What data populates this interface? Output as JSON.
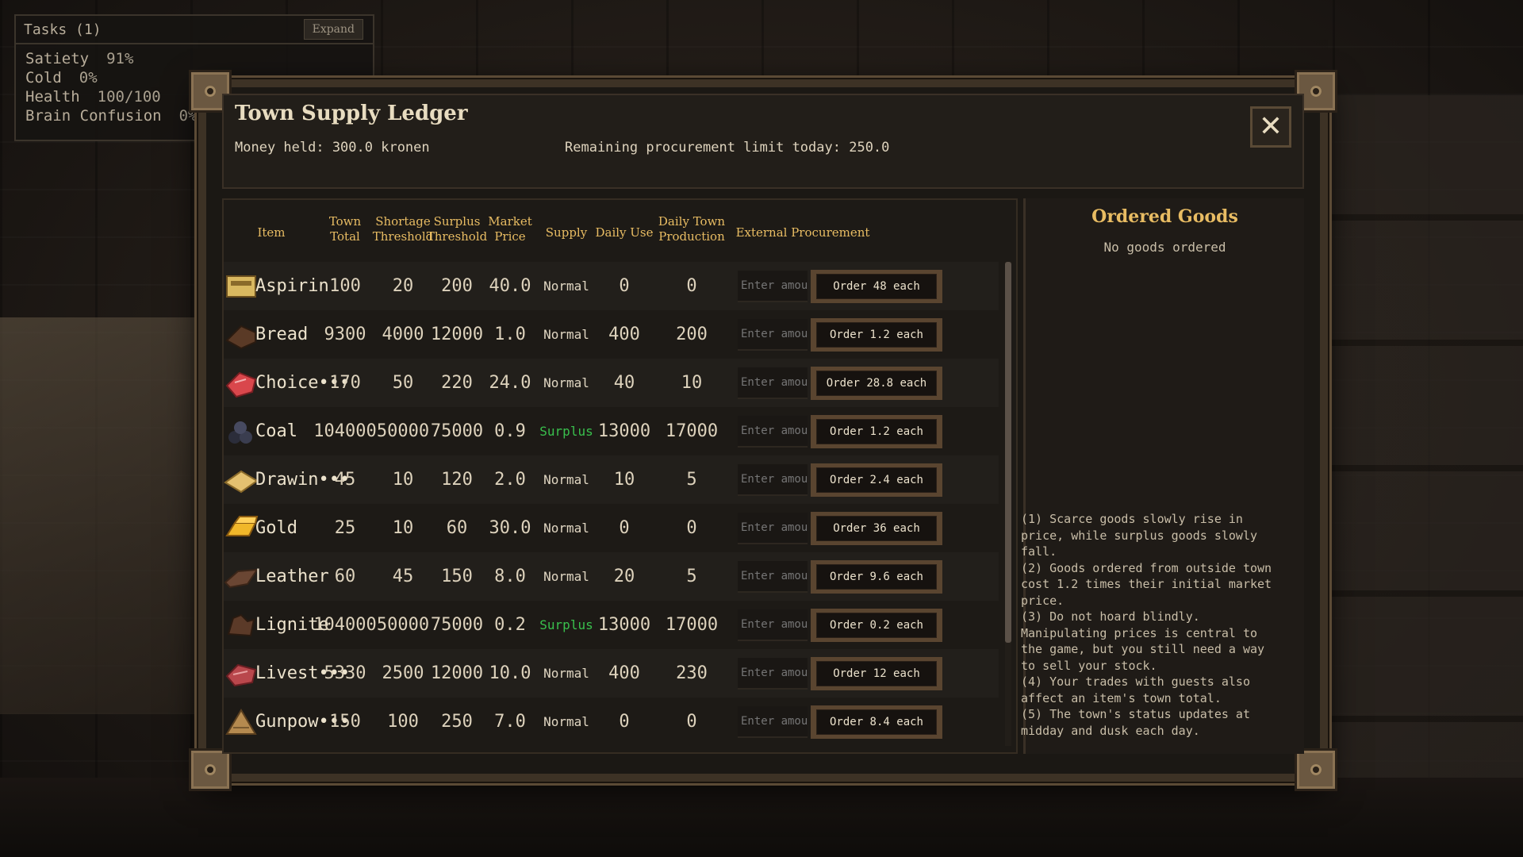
{
  "hud": {
    "title": "Tasks (1)",
    "expand_label": "Expand",
    "stats": [
      {
        "label": "Satiety",
        "value": "91%"
      },
      {
        "label": "Cold",
        "value": "0%"
      },
      {
        "label": "Health",
        "value": "100/100"
      },
      {
        "label": "Brain Confusion",
        "value": "0%"
      }
    ]
  },
  "window": {
    "title": "Town Supply Ledger",
    "money": "Money held: 300.0 kronen",
    "limit": "Remaining procurement limit today: 250.0",
    "close_icon": "close-icon"
  },
  "table": {
    "headers": {
      "item": "Item",
      "town_total": "Town\nTotal",
      "shortage": "Shortage\nThreshold",
      "surplus": "Surplus\nThreshold",
      "market": "Market\nPrice",
      "supply": "Supply",
      "daily_use": "Daily Use",
      "daily_prod": "Daily Town\nProduction",
      "external": "External Procurement"
    },
    "input_placeholder": "Enter amou",
    "rows": [
      {
        "icon": "aspirin-box-icon",
        "name": "Aspirin",
        "total": "100",
        "shortage": "20",
        "surplus": "200",
        "price": "40.0",
        "supply": "Normal",
        "use": "0",
        "prod": "0",
        "order": "Order 48 each",
        "color": "#d9b860"
      },
      {
        "icon": "bread-icon",
        "name": "Bread",
        "total": "9300",
        "shortage": "4000",
        "surplus": "12000",
        "price": "1.0",
        "supply": "Normal",
        "use": "400",
        "prod": "200",
        "order": "Order 1.2 each",
        "color": "#5a3a26"
      },
      {
        "icon": "meat-icon",
        "name": "Choice•••",
        "total": "170",
        "shortage": "50",
        "surplus": "220",
        "price": "24.0",
        "supply": "Normal",
        "use": "40",
        "prod": "10",
        "order": "Order 28.8 each",
        "color": "#d9474c"
      },
      {
        "icon": "coal-icon",
        "name": "Coal",
        "total": "104000",
        "shortage": "50000",
        "surplus": "75000",
        "price": "0.9",
        "supply": "Surplus",
        "use": "13000",
        "prod": "17000",
        "order": "Order 1.2 each",
        "color": "#2b2d3a"
      },
      {
        "icon": "drawing-paper-icon",
        "name": "Drawin•••",
        "total": "45",
        "shortage": "10",
        "surplus": "120",
        "price": "2.0",
        "supply": "Normal",
        "use": "10",
        "prod": "5",
        "order": "Order 2.4 each",
        "color": "#e4c170"
      },
      {
        "icon": "gold-bar-icon",
        "name": "Gold",
        "total": "25",
        "shortage": "10",
        "surplus": "60",
        "price": "30.0",
        "supply": "Normal",
        "use": "0",
        "prod": "0",
        "order": "Order 36 each",
        "color": "#f0b72a"
      },
      {
        "icon": "leather-icon",
        "name": "Leather",
        "total": "60",
        "shortage": "45",
        "surplus": "150",
        "price": "8.0",
        "supply": "Normal",
        "use": "20",
        "prod": "5",
        "order": "Order 9.6 each",
        "color": "#6a4633"
      },
      {
        "icon": "lignite-icon",
        "name": "Lignite",
        "total": "104000",
        "shortage": "50000",
        "surplus": "75000",
        "price": "0.2",
        "supply": "Surplus",
        "use": "13000",
        "prod": "17000",
        "order": "Order 0.2 each",
        "color": "#5b3a28"
      },
      {
        "icon": "livestock-meat-icon",
        "name": "Livest•••",
        "total": "5330",
        "shortage": "2500",
        "surplus": "12000",
        "price": "10.0",
        "supply": "Normal",
        "use": "400",
        "prod": "230",
        "order": "Order 12 each",
        "color": "#b9474c"
      },
      {
        "icon": "gunpowder-pile-icon",
        "name": "Gunpow•••",
        "total": "150",
        "shortage": "100",
        "surplus": "250",
        "price": "7.0",
        "supply": "Normal",
        "use": "0",
        "prod": "0",
        "order": "Order 8.4 each",
        "color": "#b58a4f"
      }
    ]
  },
  "ordered": {
    "title": "Ordered Goods",
    "empty": "No goods ordered",
    "tips": [
      "(1) Scarce goods slowly rise in\nprice, while surplus goods slowly\nfall.",
      "(2) Goods ordered from outside town\ncost 1.2 times their initial market\nprice.",
      "(3) Do not hoard blindly.\nManipulating prices is central to\nthe game, but you still need a way\nto sell your stock.",
      "(4) Your trades with guests also\naffect an item's town total.",
      "(5) The town's status updates at\nmidday and dusk each day."
    ]
  }
}
